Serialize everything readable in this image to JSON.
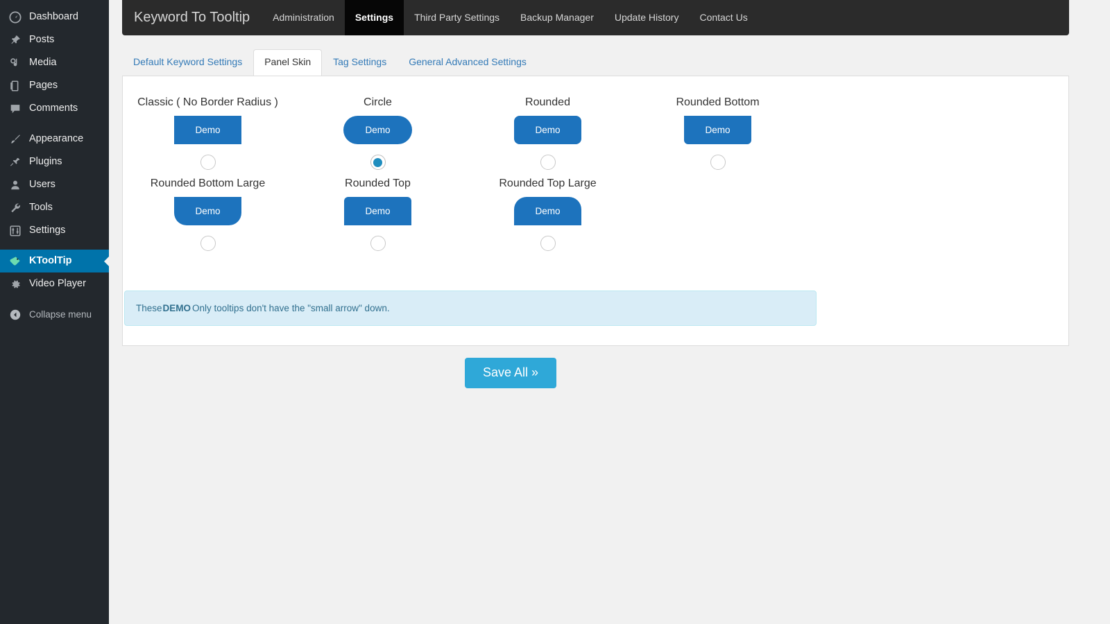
{
  "colors": {
    "sidebar_bg": "#23282d",
    "sidebar_active": "#0073aa",
    "navbar_bg": "#2b2b2b",
    "navbar_active": "#060606",
    "demo_blue": "#1d73bd",
    "save_blue": "#2fa8d8",
    "notice_bg": "#d9edf7",
    "notice_text": "#31708f",
    "radio_dot": "#1f8dbe",
    "page_bg": "#f1f1f1"
  },
  "sidebar": {
    "items": [
      {
        "label": "Dashboard",
        "icon": "dashboard-icon",
        "current": false
      },
      {
        "label": "Posts",
        "icon": "pin-icon",
        "current": false
      },
      {
        "label": "Media",
        "icon": "media-icon",
        "current": false
      },
      {
        "label": "Pages",
        "icon": "pages-icon",
        "current": false
      },
      {
        "label": "Comments",
        "icon": "comment-icon",
        "current": false
      },
      {
        "label": "Appearance",
        "icon": "brush-icon",
        "current": false
      },
      {
        "label": "Plugins",
        "icon": "plug-icon",
        "current": false
      },
      {
        "label": "Users",
        "icon": "user-icon",
        "current": false
      },
      {
        "label": "Tools",
        "icon": "wrench-icon",
        "current": false
      },
      {
        "label": "Settings",
        "icon": "sliders-icon",
        "current": false
      },
      {
        "label": "KToolTip",
        "icon": "tag-icon",
        "current": true
      },
      {
        "label": "Video Player",
        "icon": "gear-icon",
        "current": false
      }
    ],
    "collapse": {
      "label": "Collapse menu",
      "icon": "collapse-arrow-icon"
    }
  },
  "navbar": {
    "brand": "Keyword To Tooltip",
    "links": [
      {
        "label": "Administration",
        "active": false
      },
      {
        "label": "Settings",
        "active": true
      },
      {
        "label": "Third Party Settings",
        "active": false
      },
      {
        "label": "Backup Manager",
        "active": false
      },
      {
        "label": "Update History",
        "active": false
      },
      {
        "label": "Contact Us",
        "active": false
      }
    ]
  },
  "tabs": [
    {
      "label": "Default Keyword Settings",
      "active": false
    },
    {
      "label": "Panel Skin",
      "active": true
    },
    {
      "label": "Tag Settings",
      "active": false
    },
    {
      "label": "General Advanced Settings",
      "active": false
    }
  ],
  "panel_skin": {
    "demo_label": "Demo",
    "skins": [
      {
        "title": "Classic ( No Border Radius )",
        "radius_class": "r-none",
        "selected": false
      },
      {
        "title": "Circle",
        "radius_class": "r-circle",
        "selected": true
      },
      {
        "title": "Rounded",
        "radius_class": "r-all",
        "selected": false
      },
      {
        "title": "Rounded Bottom",
        "radius_class": "r-bot",
        "selected": false
      },
      {
        "title": "Rounded Bottom Large",
        "radius_class": "r-bot-lg",
        "selected": false
      },
      {
        "title": "Rounded Top",
        "radius_class": "r-top",
        "selected": false
      },
      {
        "title": "Rounded Top Large",
        "radius_class": "r-top-lg",
        "selected": false
      }
    ],
    "notice": {
      "prefix": "These ",
      "strong": "DEMO",
      "suffix": " Only tooltips don't have the \"small arrow\" down."
    }
  },
  "footer": {
    "save_label": "Save All »"
  }
}
